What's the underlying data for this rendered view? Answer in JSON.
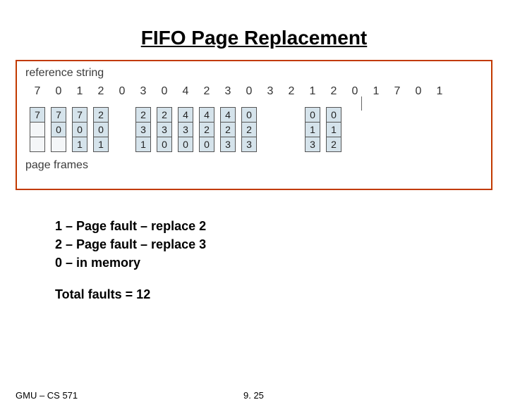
{
  "title": "FIFO Page Replacement",
  "labels": {
    "reference": "reference string",
    "frames": "page frames"
  },
  "reference_string": [
    "7",
    "0",
    "1",
    "2",
    "0",
    "3",
    "0",
    "4",
    "2",
    "3",
    "0",
    "3",
    "2",
    "1",
    "2",
    "0",
    "1",
    "7",
    "0",
    "1"
  ],
  "frame_columns": [
    {
      "idx": 0,
      "show": true,
      "cells": [
        "7",
        "",
        ""
      ],
      "empties": [
        false,
        true,
        true
      ]
    },
    {
      "idx": 1,
      "show": true,
      "cells": [
        "7",
        "0",
        ""
      ],
      "empties": [
        false,
        false,
        true
      ]
    },
    {
      "idx": 2,
      "show": true,
      "cells": [
        "7",
        "0",
        "1"
      ],
      "empties": [
        false,
        false,
        false
      ]
    },
    {
      "idx": 3,
      "show": true,
      "cells": [
        "2",
        "0",
        "1"
      ],
      "empties": [
        false,
        false,
        false
      ]
    },
    {
      "idx": 4,
      "show": false
    },
    {
      "idx": 5,
      "show": true,
      "cells": [
        "2",
        "3",
        "1"
      ],
      "empties": [
        false,
        false,
        false
      ]
    },
    {
      "idx": 6,
      "show": true,
      "cells": [
        "2",
        "3",
        "0"
      ],
      "empties": [
        false,
        false,
        false
      ]
    },
    {
      "idx": 7,
      "show": true,
      "cells": [
        "4",
        "3",
        "0"
      ],
      "empties": [
        false,
        false,
        false
      ]
    },
    {
      "idx": 8,
      "show": true,
      "cells": [
        "4",
        "2",
        "0"
      ],
      "empties": [
        false,
        false,
        false
      ]
    },
    {
      "idx": 9,
      "show": true,
      "cells": [
        "4",
        "2",
        "3"
      ],
      "empties": [
        false,
        false,
        false
      ]
    },
    {
      "idx": 10,
      "show": true,
      "cells": [
        "0",
        "2",
        "3"
      ],
      "empties": [
        false,
        false,
        false
      ]
    },
    {
      "idx": 11,
      "show": false
    },
    {
      "idx": 12,
      "show": false
    },
    {
      "idx": 13,
      "show": true,
      "cells": [
        "0",
        "1",
        "3"
      ],
      "empties": [
        false,
        false,
        false
      ]
    },
    {
      "idx": 14,
      "show": true,
      "cells": [
        "0",
        "1",
        "2"
      ],
      "empties": [
        false,
        false,
        false
      ]
    },
    {
      "idx": 15,
      "show": false
    },
    {
      "idx": 16,
      "show": false
    },
    {
      "idx": 17,
      "show": false
    },
    {
      "idx": 18,
      "show": false
    },
    {
      "idx": 19,
      "show": false
    }
  ],
  "notes": [
    "1 – Page fault – replace 2",
    "2 – Page fault – replace 3",
    "0 – in memory"
  ],
  "total": "Total faults = 12",
  "footer": {
    "left": "GMU – CS 571",
    "center": "9. 25"
  }
}
